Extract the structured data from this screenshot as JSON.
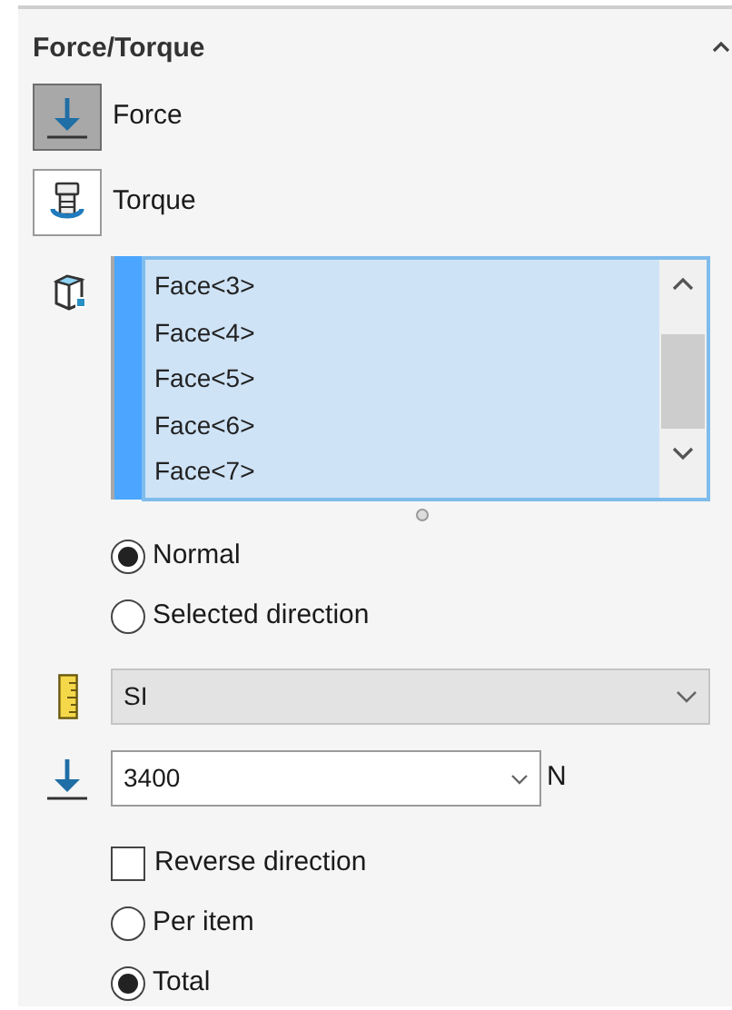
{
  "panel": {
    "title": "Force/Torque",
    "expanded": true
  },
  "type_buttons": [
    {
      "label": "Force",
      "selected": true,
      "kind": "force"
    },
    {
      "label": "Torque",
      "selected": false,
      "kind": "torque"
    }
  ],
  "selection_list": {
    "items": [
      "Face<3>",
      "Face<4>",
      "Face<5>",
      "Face<6>",
      "Face<7>"
    ]
  },
  "direction_options": [
    {
      "label": "Normal",
      "selected": true
    },
    {
      "label": "Selected direction",
      "selected": false
    }
  ],
  "unit_system": {
    "value": "SI"
  },
  "force_value": {
    "value": "3400",
    "unit": "N"
  },
  "reverse_direction": {
    "label": "Reverse direction",
    "checked": false
  },
  "distribution_options": [
    {
      "label": "Per item",
      "selected": false
    },
    {
      "label": "Total",
      "selected": true
    }
  ]
}
